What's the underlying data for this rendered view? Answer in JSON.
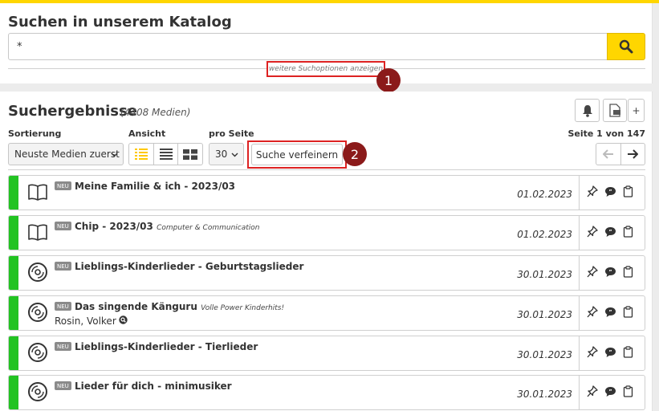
{
  "search": {
    "heading": "Suchen in unserem Katalog",
    "query": "*",
    "more_options": "weitere Suchoptionen anzeigen"
  },
  "markers": [
    "1",
    "2"
  ],
  "results": {
    "heading": "Suchergebnisse",
    "count": "(4408 Medien)",
    "sort_label": "Sortierung",
    "sort_value": "Neuste Medien zuerst",
    "view_label": "Ansicht",
    "per_page_label": "pro Seite",
    "per_page_value": "30",
    "refine_button": "Suche verfeinern",
    "page_info": "Seite 1 von 147",
    "add_button": "+"
  },
  "items": [
    {
      "type": "book-icon",
      "badge": "NEU",
      "title": "Meine Familie & ich - 2023/03",
      "subtitle": "",
      "author": "",
      "date": "01.02.2023"
    },
    {
      "type": "book-icon",
      "badge": "NEU",
      "title": "Chip - 2023/03",
      "subtitle": "Computer & Communication",
      "author": "",
      "date": "01.02.2023"
    },
    {
      "type": "cd-icon",
      "badge": "NEU",
      "title": "Lieblings-Kinderlieder - Geburtstagslieder",
      "subtitle": "",
      "author": "",
      "date": "30.01.2023"
    },
    {
      "type": "cd-icon",
      "badge": "NEU",
      "title": "Das singende Känguru",
      "subtitle": "Volle Power Kinderhits!",
      "author": "Rosin, Volker",
      "date": "30.01.2023"
    },
    {
      "type": "cd-icon",
      "badge": "NEU",
      "title": "Lieblings-Kinderlieder - Tierlieder",
      "subtitle": "",
      "author": "",
      "date": "30.01.2023"
    },
    {
      "type": "cd-icon",
      "badge": "NEU",
      "title": "Lieder für dich - minimusiker",
      "subtitle": "",
      "author": "",
      "date": "30.01.2023"
    }
  ],
  "colors": {
    "accent": "#ffd600",
    "available": "#22c322",
    "marker": "#8b1a1a",
    "highlight": "#dd2222"
  }
}
